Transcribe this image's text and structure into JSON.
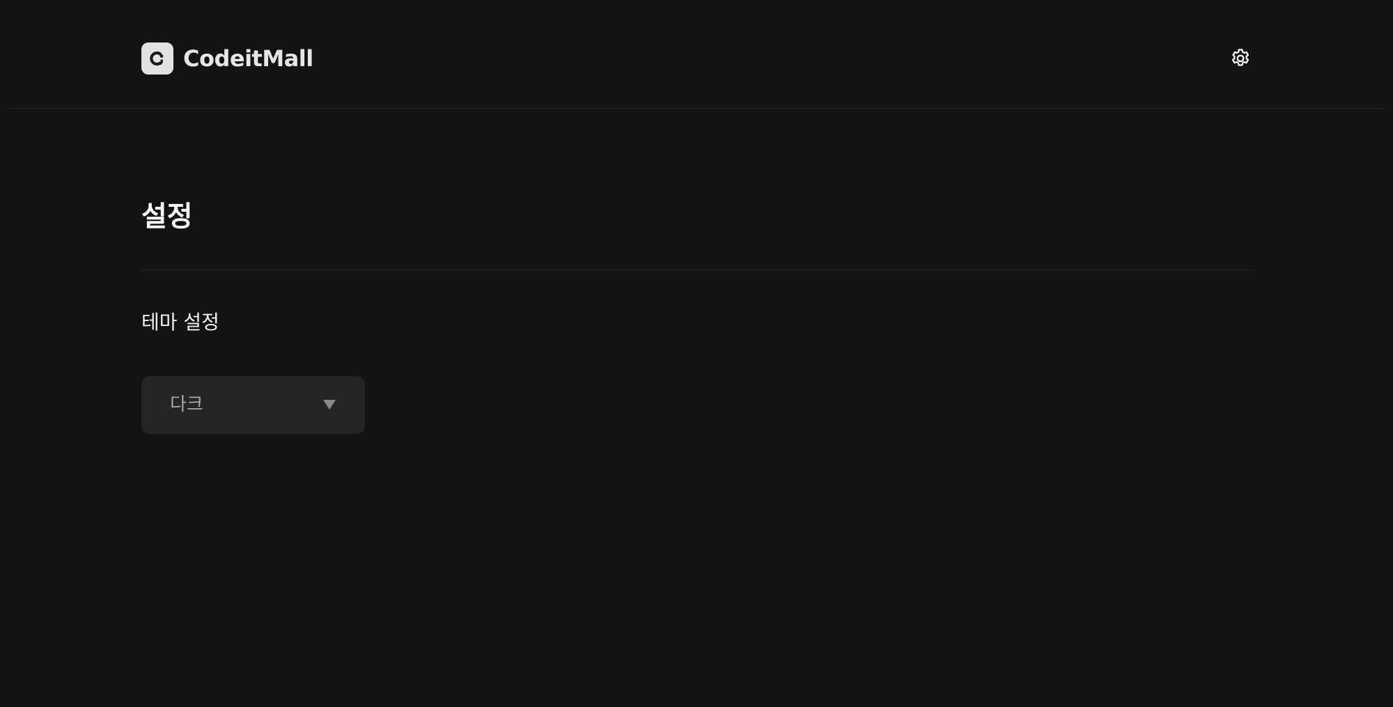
{
  "header": {
    "logo_text": "CodeitMall",
    "logo_icon": "codeit-logo-icon",
    "settings_icon": "gear-icon"
  },
  "main": {
    "title": "설정",
    "section": {
      "label": "테마 설정",
      "select": {
        "value": "다크",
        "icon": "caret-down-icon"
      }
    }
  },
  "colors": {
    "background": "#131313",
    "select_background": "#252525",
    "logo_mark": "#e2e2e2",
    "divider": "#2a2a2a"
  }
}
